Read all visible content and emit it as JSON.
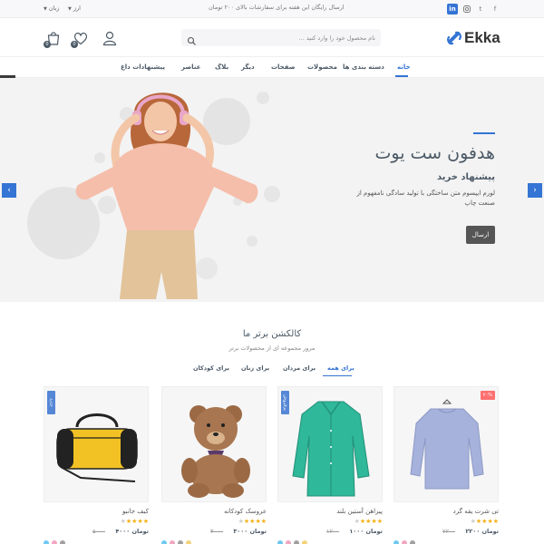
{
  "topbar": {
    "promo": "ارسال رایگان این هفته برای سفارشات بالای ۲۰۰ تومان",
    "currency_label": "ارز",
    "language_label": "زبان",
    "social": [
      "f",
      "t",
      "ig",
      "in"
    ]
  },
  "header": {
    "logo_text": "Ekka",
    "search_placeholder": "نام محصول خود را وارد کنید ...",
    "cart_count": "0",
    "wishlist_count": "0"
  },
  "nav": {
    "items": [
      "خانه",
      "دسته بندی ها",
      "محصولات",
      "صفحات",
      "دیگر",
      "بلاگ",
      "عناصر",
      "پیشنهادات داغ"
    ]
  },
  "hero": {
    "title": "هدفون ست یوت",
    "subtitle": "پیشنهاد خرید",
    "description": "لورم ایپسوم متن ساختگی با تولید سادگی نامفهوم از صنعت چاپ",
    "button": "ارسال"
  },
  "collection": {
    "title": "کالکشن برتر ما",
    "subtitle": "مرور مجموعه ای از محصولات برتر",
    "tabs": [
      "برای همه",
      "برای مردان",
      "برای زنان",
      "برای کودکان"
    ]
  },
  "products": [
    {
      "name": "تی شرت یقه گرد",
      "price": "۲۲۰۰ تومان",
      "old_price": "۲۲۰۰",
      "rating": 4,
      "flag": "۲۰%",
      "colors": [
        "#6fc9f1",
        "#f3a6c2",
        "#a0a0a0"
      ]
    },
    {
      "name": "پیراهن آستین بلند",
      "price": "۱۰۰۰ تومان",
      "old_price": "۱۲۰۰",
      "rating": 4,
      "flag": "پرفروش",
      "colors": [
        "#6fc9f1",
        "#f3a6c2",
        "#a0a0a0",
        "#f3d37a"
      ]
    },
    {
      "name": "عروسک کودکانه",
      "price": "۳۰۰۰ تومان",
      "old_price": "۳۰۰۰",
      "rating": 4,
      "flag": "",
      "colors": [
        "#6fc9f1",
        "#f3a6c2",
        "#a0a0a0",
        "#f3d37a"
      ]
    },
    {
      "name": "کیف جانبو",
      "price": "۴۰۰۰ تومان",
      "old_price": "۵۰۰۰",
      "rating": 4,
      "flag": "جدید",
      "colors": [
        "#6fc9f1",
        "#f3a6c2",
        "#a0a0a0"
      ]
    }
  ],
  "colors": {
    "accent": "#3474d4",
    "text": "#4b5966",
    "sale": "#ff7070"
  }
}
